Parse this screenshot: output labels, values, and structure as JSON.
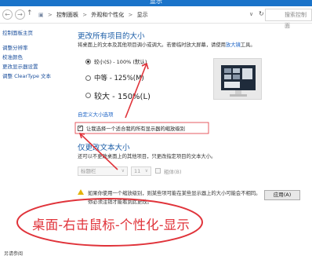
{
  "window": {
    "title": "显示"
  },
  "address_bar": {
    "back": "←",
    "forward": "→",
    "up": "↑",
    "crumbs": [
      "控制面板",
      "外观和个性化",
      "显示"
    ],
    "separator": ">",
    "search_placeholder": "搜索控制面"
  },
  "sidebar": {
    "items": [
      "控制面板主页",
      "调整分辨率",
      "校准颜色",
      "更改显示器设置",
      "调整 ClearType 文本"
    ]
  },
  "main": {
    "title": "更改所有项目的大小",
    "description": "将桌面上的文本及其他项目调小或调大。若要临时放大屏幕，请使用",
    "magnifier_link": "放大镜",
    "description_end": "工具。",
    "options": [
      {
        "label": "较小(S) - 100% (默认)",
        "selected": true
      },
      {
        "label": "中等 - 125%(M)",
        "selected": false
      },
      {
        "label": "较大 - 150%(L)",
        "selected": false
      }
    ],
    "custom_size_link": "自定义大小选项",
    "single_scale_checkbox": {
      "label": "让我选择一个适合我的所有显示器的缩放级别",
      "checked": true
    }
  },
  "text_size": {
    "title": "仅更改文本大小",
    "description": "还可以不更改桌面上的其他项目，只更改指定项目的文本大小。",
    "item_select": "标题栏",
    "size_select": "11",
    "bold_label": "粗体(B)"
  },
  "warning": {
    "line1": "如果你使用一个缩放级别，则某些项可能在某些显示器上的大小可能会不相同。",
    "line2": "你必须注销才能看到此更改。"
  },
  "apply_button": "应用(A)",
  "footer": {
    "see_also": "另请参阅"
  },
  "annotation": {
    "text": "桌面-右击鼠标-个性化-显示",
    "color": "#e0333a"
  }
}
